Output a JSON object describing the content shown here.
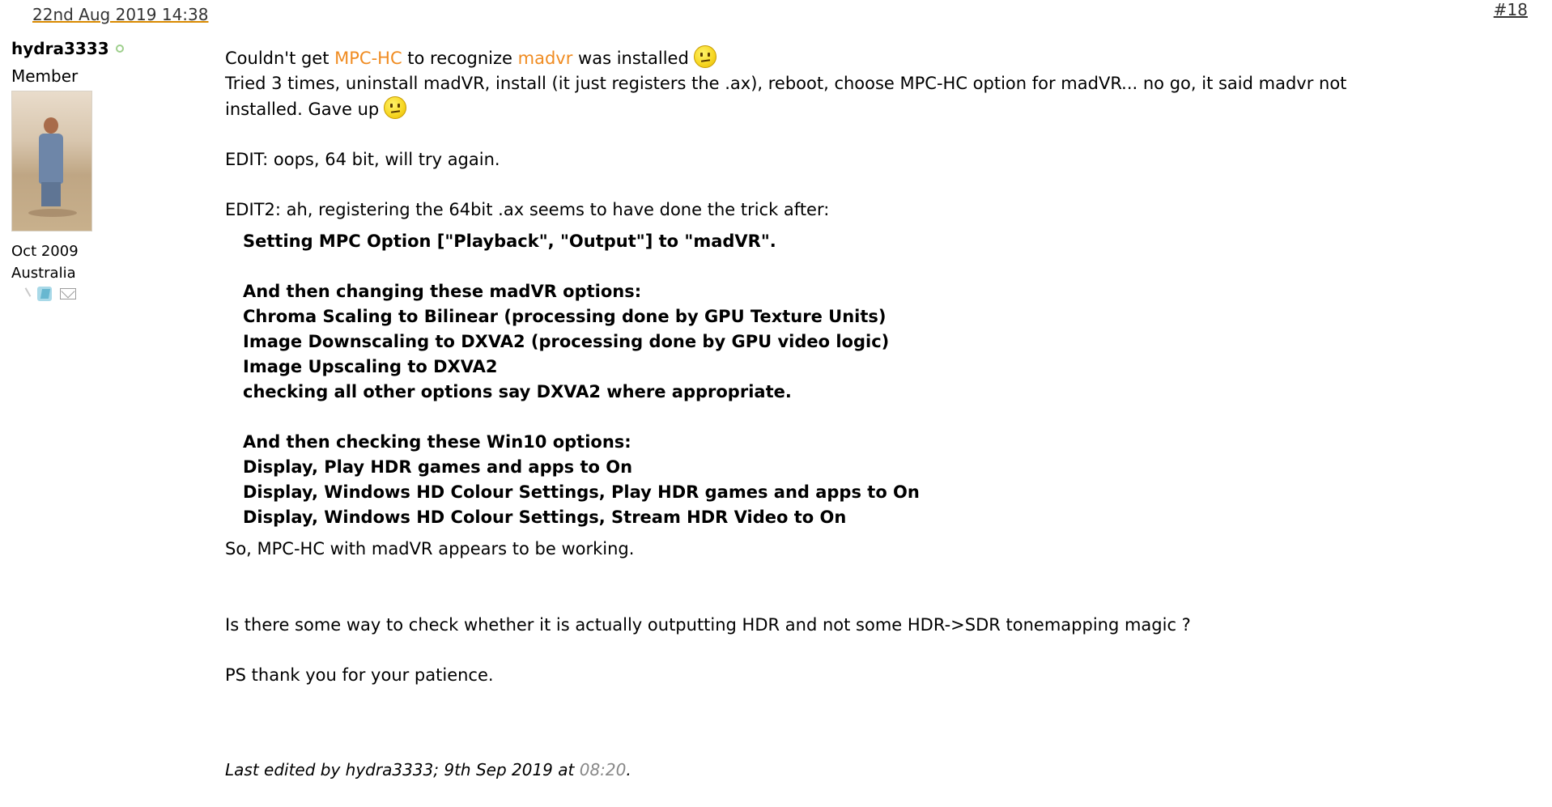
{
  "post": {
    "date": "22nd Aug 2019 14:38",
    "number": "#18"
  },
  "user": {
    "name": "hydra3333",
    "title": "Member",
    "join_date": "Oct 2009",
    "location": "Australia"
  },
  "message": {
    "line1_a": "Couldn't get ",
    "line1_link1": "MPC-HC",
    "line1_b": " to recognize ",
    "line1_link2": "madvr",
    "line1_c": " was installed",
    "line2": "Tried 3 times, uninstall madVR, install (it just registers the .ax), reboot, choose MPC-HC option for madVR... no go, it said madvr not",
    "line3": "installed. Gave up",
    "edit1": "EDIT: oops, 64 bit, will try again.",
    "edit2": "EDIT2: ah, registering the 64bit .ax seems to have done the trick after:",
    "bold_lines": [
      "Setting MPC Option [\"Playback\", \"Output\"] to \"madVR\".",
      "",
      "And then changing these madVR options:",
      "Chroma Scaling to Bilinear (processing done by GPU Texture Units)",
      "Image Downscaling to DXVA2 (processing done by GPU video logic)",
      "Image Upscaling to DXVA2",
      "checking all other options say DXVA2 where appropriate.",
      "",
      "And then checking these Win10 options:",
      "Display, Play HDR games and apps to On",
      "Display, Windows HD Colour Settings, Play HDR games and apps to On",
      "Display, Windows HD Colour Settings, Stream HDR Video to On"
    ],
    "working": "So, MPC-HC with madVR appears to be working.",
    "question": "Is there some way to check whether it is actually outputting HDR and not some HDR->SDR tonemapping magic ?",
    "thanks": "PS thank you for your patience."
  },
  "last_edited": {
    "prefix": "Last edited by hydra3333; 9th Sep 2019 at ",
    "time": "08:20",
    "suffix": "."
  },
  "icons": {
    "online_status": "online-status-icon",
    "smiley": "sad-smiley-icon",
    "profile": "profile-icon",
    "blog": "blog-icon",
    "mail": "mail-icon"
  }
}
